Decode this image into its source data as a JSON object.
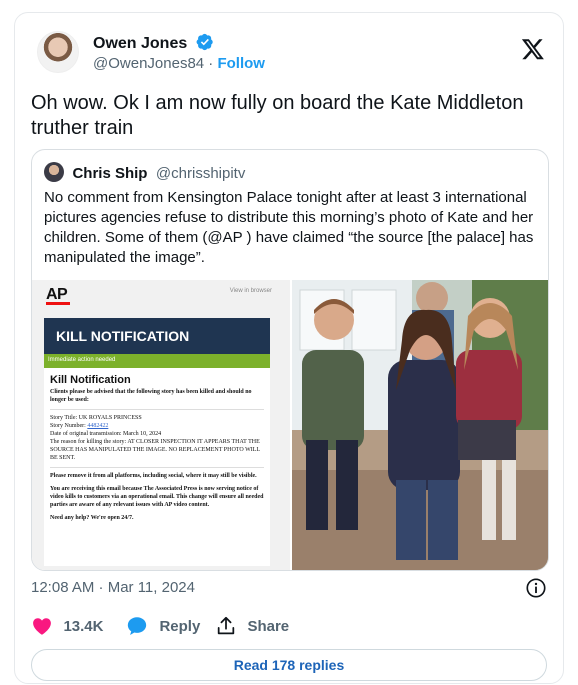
{
  "author": {
    "name": "Owen Jones",
    "handle": "@OwenJones84",
    "separator": "·",
    "follow_label": "Follow"
  },
  "tweet": {
    "text": "Oh wow. Ok I am now fully on board the Kate Middleton truther train",
    "timestamp": "12:08 AM · Mar 11, 2024"
  },
  "quoted": {
    "name": "Chris Ship",
    "handle": "@chrisshipitv",
    "text": "No comment from Kensington Palace tonight after at least 3 international pictures agencies refuse to distribute this morning’s photo of Kate and her children.  Some of them (@AP ) have claimed “the source [the palace] has manipulated the image”."
  },
  "ap_notice": {
    "logo": "AP",
    "view_in_browser": "View in browser",
    "banner": "KILL NOTIFICATION",
    "bar": "Immediate action needed",
    "title": "Kill Notification",
    "intro": "Clients please be advised that the following story has been killed and should no longer be used:",
    "story_title": "Story Title: UK ROYALS PRINCESS",
    "story_number_label": "Story Number: ",
    "story_number": "4482422",
    "date": "Date of original transmission: March 10, 2024",
    "reason": "The reason for killing the story: AT CLOSER INSPECTION IT APPEARS THAT THE SOURCE HAS MANIPULATED THE IMAGE. NO REPLACEMENT PHOTO WILL BE SENT.",
    "remove": "Please remove it from all platforms, including social, where it may still be visible.",
    "receiving": "You are receiving this email because The Associated Press is now serving notice of video kills to customers via an operational email. This change will ensure all needed parties are aware of any relevant issues with AP video content.",
    "help": "Need any help? We're open 24/7."
  },
  "actions": {
    "likes": "13.4K",
    "reply_label": "Reply",
    "share_label": "Share",
    "read_replies": "Read 178 replies"
  },
  "colors": {
    "accent": "#1d9bf0",
    "like": "#f91880",
    "muted": "#536471",
    "ap_banner": "#1f3551",
    "ap_green": "#7cb12b"
  },
  "icons": [
    "verified-badge-icon",
    "x-logo-icon",
    "info-icon",
    "heart-icon",
    "reply-bubble-icon",
    "share-icon"
  ]
}
